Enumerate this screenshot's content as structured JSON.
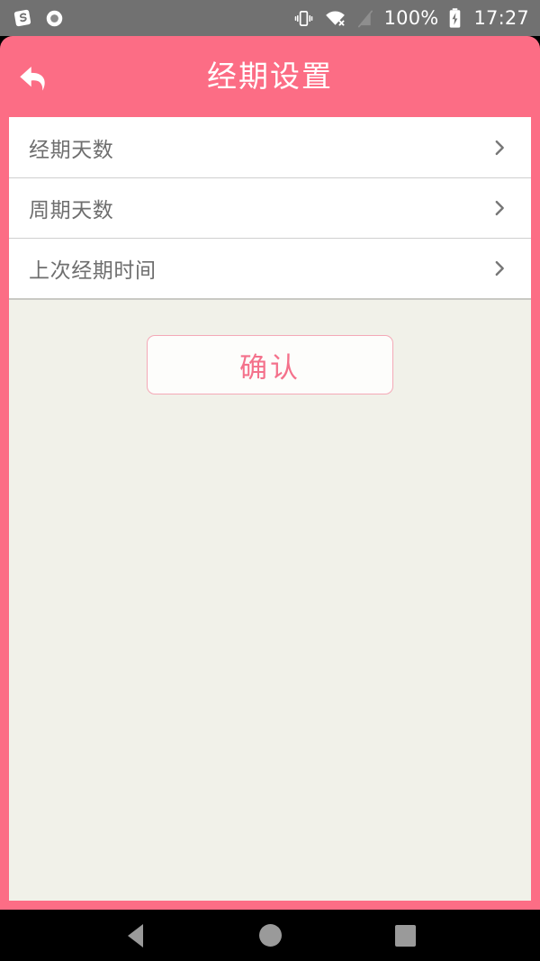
{
  "status_bar": {
    "background_color": "#717171",
    "left_icons": [
      {
        "name": "sogou-input-icon",
        "glyph": "S"
      },
      {
        "name": "circle-record-icon",
        "glyph": "circle"
      }
    ],
    "right_icons": [
      {
        "name": "vibrate-mode-icon"
      },
      {
        "name": "wifi-disconnected-icon"
      },
      {
        "name": "no-sim-signal-icon"
      }
    ],
    "battery_percent": "100%",
    "battery_state": "charging",
    "clock": "17:27"
  },
  "header": {
    "title": "经期设置",
    "back_icon": "back-arrow-icon",
    "background_color": "#fc6d85",
    "title_color": "#ffffff"
  },
  "content": {
    "background_color": "#f1f1e9"
  },
  "settings": {
    "rows": [
      {
        "label": "经期天数",
        "chevron": "chevron-right-icon"
      },
      {
        "label": "周期天数",
        "chevron": "chevron-right-icon"
      },
      {
        "label": "上次经期时间",
        "chevron": "chevron-right-icon"
      }
    ]
  },
  "confirm": {
    "label": "确认",
    "text_color": "#f4718b",
    "border_color": "#f4a9b7",
    "background_color": "#fdfdfb"
  },
  "nav_bar": {
    "background_color": "#000000",
    "icon_color": "#9a9a9a",
    "buttons": [
      {
        "name": "nav-back-button",
        "icon": "triangle-left-icon"
      },
      {
        "name": "nav-home-button",
        "icon": "circle-icon"
      },
      {
        "name": "nav-recents-button",
        "icon": "square-icon"
      }
    ]
  }
}
